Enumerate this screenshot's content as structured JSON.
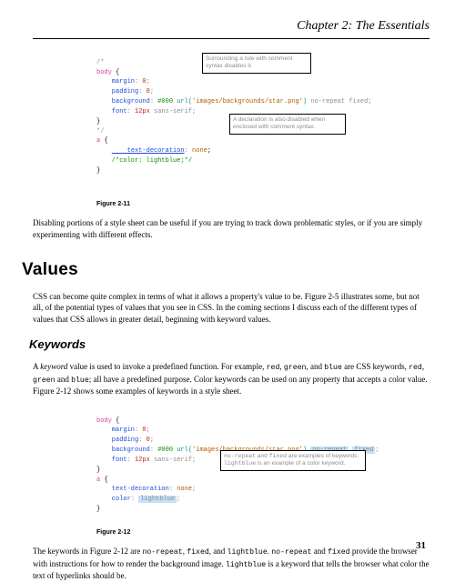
{
  "chapter_title": "Chapter 2: The Essentials",
  "fig211": {
    "annot_top": "Surrounding a rule with comment syntax disables it.",
    "annot_bot": "A declaration is also disabled when enclosed with comment syntax.",
    "caption": "Figure 2-11",
    "code_lines": {
      "l1": "/*",
      "l2a": "body",
      "l2b": " {",
      "l3a": "    margin",
      "l3b": ": ",
      "l3c": "0",
      "l3d": ";",
      "l4a": "    padding",
      "l4b": ": ",
      "l4c": "0",
      "l4d": ";",
      "l5a": "    background",
      "l5b": ": ",
      "l5c": "#000",
      "l5d": " url(",
      "l5e": "'images/backgrounds/star.png'",
      "l5f": ") ",
      "l5g": "no-repeat",
      "l5h": " ",
      "l5i": "fixed",
      "l5j": ";",
      "l6a": "    font",
      "l6b": ": ",
      "l6c": "12px",
      "l6d": " ",
      "l6e": "sans-serif",
      "l6f": ";",
      "l7": "}",
      "l8": "*/",
      "l9a": "a",
      "l9b": " {",
      "l10a": "    text-decoration",
      "l10b": ": ",
      "l10c": "none",
      "l10d": ";",
      "l11": "    /*color: lightblue;*/",
      "l12": "}"
    }
  },
  "para_after_211": "Disabling portions of a style sheet can be useful if you are trying to track down problematic styles, or if you are simply experimenting with different effects.",
  "h2_values": "Values",
  "para_values": "CSS can become quite complex in terms of what it allows a property's value to be. Figure 2-5 illustrates some, but not all, of the potential types of values that you see in CSS. In the coming sections I discuss each of the different types of values that CSS allows in greater detail, beginning with keyword values.",
  "h3_keywords": "Keywords",
  "para_keywords_a": "A ",
  "para_keywords_b": "keyword",
  "para_keywords_c": " value is used to invoke a predefined function. For example, ",
  "kw_red": "red",
  "comma1": ", ",
  "kw_green": "green",
  "comma2": ", and ",
  "kw_blue": "blue",
  "para_keywords_d": " are CSS keywords, ",
  "para_keywords_e": " all have a predefined purpose. Color keywords can be used on any property that accepts a color value. Figure 2-12 shows some examples of keywords in a style sheet.",
  "kw_and": " and ",
  "semi": "; ",
  "fig212": {
    "annot": "no-repeat and fixed are examples of keywords. lightblue is an example of a color keyword.",
    "annot_code1": "no-repeat",
    "annot_txt1": " and ",
    "annot_code2": "fixed",
    "annot_txt2": " are examples of keywords. ",
    "annot_code3": "lightblue",
    "annot_txt3": " is an example of a color keyword.",
    "caption": "Figure 2-12",
    "code_lines": {
      "l1a": "body",
      "l1b": " {",
      "l2a": "    margin",
      "l2b": ": ",
      "l2c": "0",
      "l2d": ";",
      "l3a": "    padding",
      "l3b": ": ",
      "l3c": "0",
      "l3d": ";",
      "l4a": "    background",
      "l4b": ": ",
      "l4c": "#000",
      "l4d": " url(",
      "l4e": "'images/backgrounds/star.png'",
      "l4f": ") ",
      "l4g": "no-repeat",
      "l4h": " ",
      "l4i": "fixed",
      "l4j": ";",
      "l5a": "    font",
      "l5b": ": ",
      "l5c": "12px",
      "l5d": " ",
      "l5e": "sans-serif",
      "l5f": ";",
      "l6": "}",
      "l7a": "a",
      "l7b": " {",
      "l8a": "    text-decoration",
      "l8b": ": ",
      "l8c": "none",
      "l8d": ";",
      "l9a": "    color",
      "l9b": ": ",
      "l9c": "lightblue",
      "l9d": ";",
      "l10": "}"
    }
  },
  "para_after_212_a": "The keywords in Figure 2-12 are ",
  "kw_norepeat": "no-repeat",
  "kw_fixed": "fixed",
  "kw_lightblue": "lightblue",
  "para_after_212_b": " provide the browser with instructions for how to render the background image. ",
  "para_after_212_c": " is a keyword that tells the browser what color the text of hyperlinks should be.",
  "period_sp": ". ",
  "page_number": "31"
}
